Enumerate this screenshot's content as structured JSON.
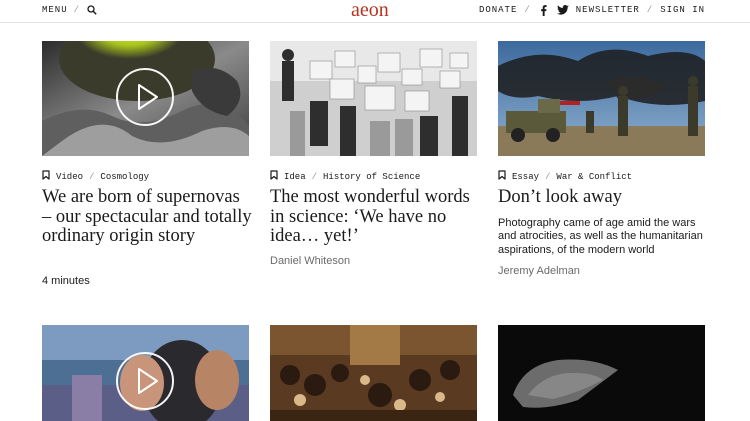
{
  "header": {
    "menu_label": "MENU",
    "separator": "/",
    "logo_text": "aeon",
    "donate_label": "DONATE",
    "newsletter_label": "NEWSLETTER",
    "signin_label": "SIGN IN",
    "logo_color": "#b5341e"
  },
  "articles": [
    {
      "type": "Video",
      "topic": "Cosmology",
      "title": "We are born of supernovas – our spectacular and totally ordinary origin story",
      "duration": "4 minutes",
      "has_play": true
    },
    {
      "type": "Idea",
      "topic": "History of Science",
      "title": "The most wonderful words in science: ‘We have no idea… yet!’",
      "author": "Daniel Whiteson"
    },
    {
      "type": "Essay",
      "topic": "War & Conflict",
      "title": "Don’t look away",
      "description": "Photography came of age amid the wars and atrocities, as well as the humanitarian aspirations, of the modern world",
      "author": "Jeremy Adelman"
    }
  ]
}
